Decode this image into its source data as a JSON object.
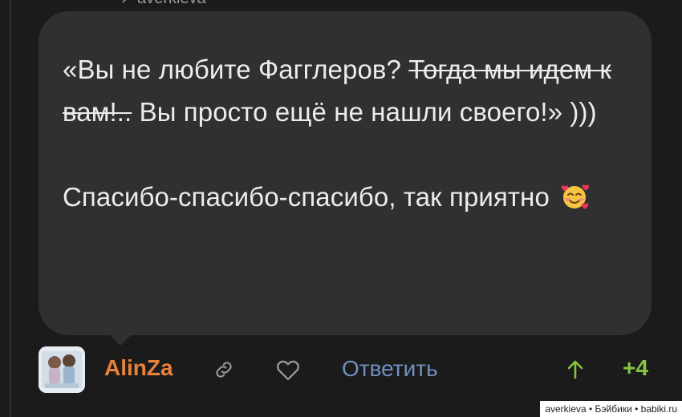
{
  "reply_ref": {
    "arrow": "↗",
    "username": "averkieva"
  },
  "comment": {
    "p1_part1": "«Вы не любите Фагглеров? ",
    "p1_strike": "Тогда мы идем к вам!..",
    "p1_part2": " Вы просто ещё не нашли своего!» )))",
    "p2_text": "Спасибо-спасибо-спасибо, так приятно",
    "emoji": "smiling-face-with-hearts-icon"
  },
  "footer": {
    "username": "AlinZa",
    "reply_label": "Ответить",
    "score": "+4",
    "icons": {
      "link": "link-icon",
      "like": "heart-icon",
      "upvote": "arrow-up-icon"
    }
  },
  "watermark": "averkieva • Бэйбики • babiki.ru",
  "colors": {
    "background": "#1b1b1b",
    "bubble": "#303030",
    "text": "#ececec",
    "username": "#e8823a",
    "reply_link": "#6f8fc2",
    "score": "#86c440"
  }
}
